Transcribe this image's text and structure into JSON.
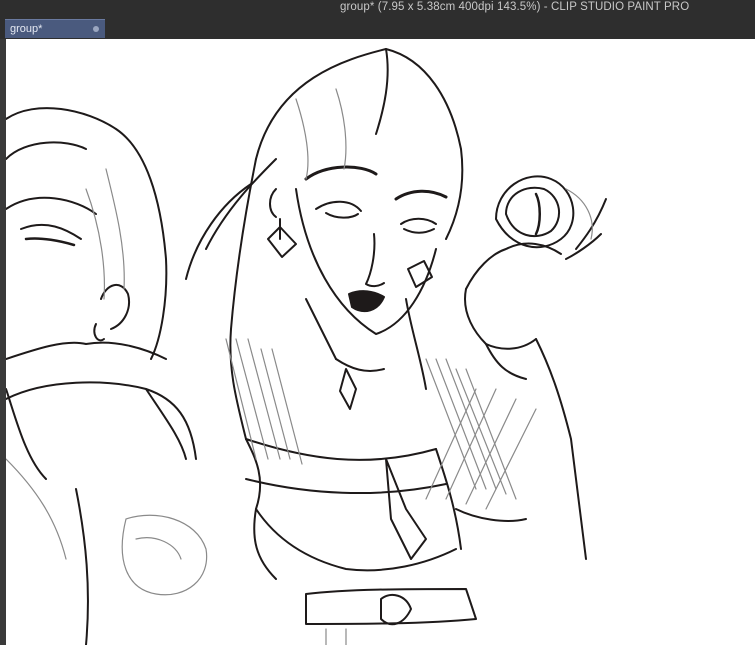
{
  "window": {
    "title": "group* (7.95 x 5.38cm 400dpi 143.5%)  - CLIP STUDIO PAINT PRO"
  },
  "tabs": [
    {
      "label": "group*",
      "active": true,
      "close_icon": "close-dot-icon"
    }
  ],
  "canvas": {
    "content": "line-art-sketch",
    "background": "#ffffff",
    "stroke_dark": "#1e1a1a",
    "stroke_light": "#8a8a8a"
  },
  "colors": {
    "app_background": "#2e2e2e",
    "tab_active": "#4a5a7e"
  }
}
